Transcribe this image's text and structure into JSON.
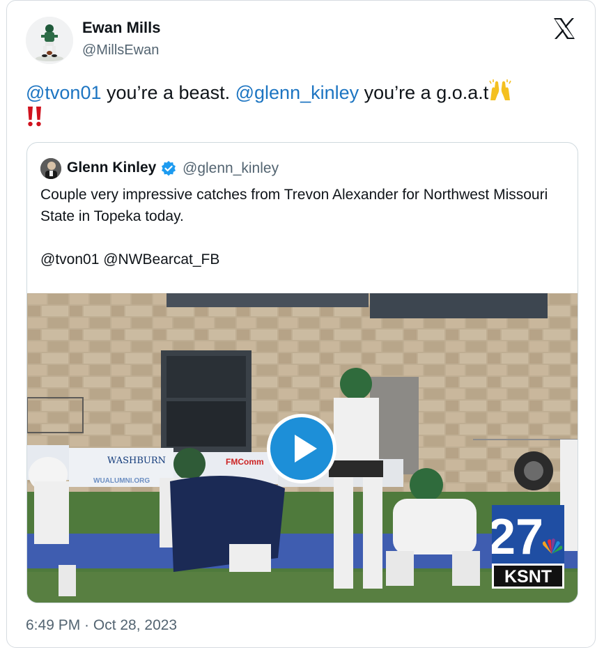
{
  "author": {
    "name": "Ewan Mills",
    "handle": "@MillsEwan",
    "avatar_icon": "football-player-avatar"
  },
  "platform_icon": "x-logo-icon",
  "tweet": {
    "mention_1": "@tvon01",
    "text_1": " you’re a beast. ",
    "mention_2": "@glenn_kinley",
    "text_2": " you’re a g.o.a.t",
    "emoji_1": "raising-hands-emoji",
    "emoji_2": "double-exclamation-emoji"
  },
  "quoted_tweet": {
    "name": "Glenn Kinley",
    "handle": "@glenn_kinley",
    "verified": true,
    "text": "Couple very impressive catches from Trevon Alexander for Northwest Missouri State in Topeka today.\n\n@tvon01 @NWBearcat_FB",
    "media": {
      "type": "video",
      "play_icon": "play-icon",
      "station_logo_number": "27",
      "station_logo_text": "KSNT",
      "sign_text_1": "WASHBURN",
      "sign_text_2": "FMComm",
      "sign_text_3": "WUALUMNI.ORG"
    }
  },
  "timestamp": "6:49 PM · Oct 28, 2023",
  "colors": {
    "mention": "#1d75c2",
    "verified": "#1d9bf0",
    "play": "#1d8fd8",
    "secondary_text": "#536471"
  }
}
